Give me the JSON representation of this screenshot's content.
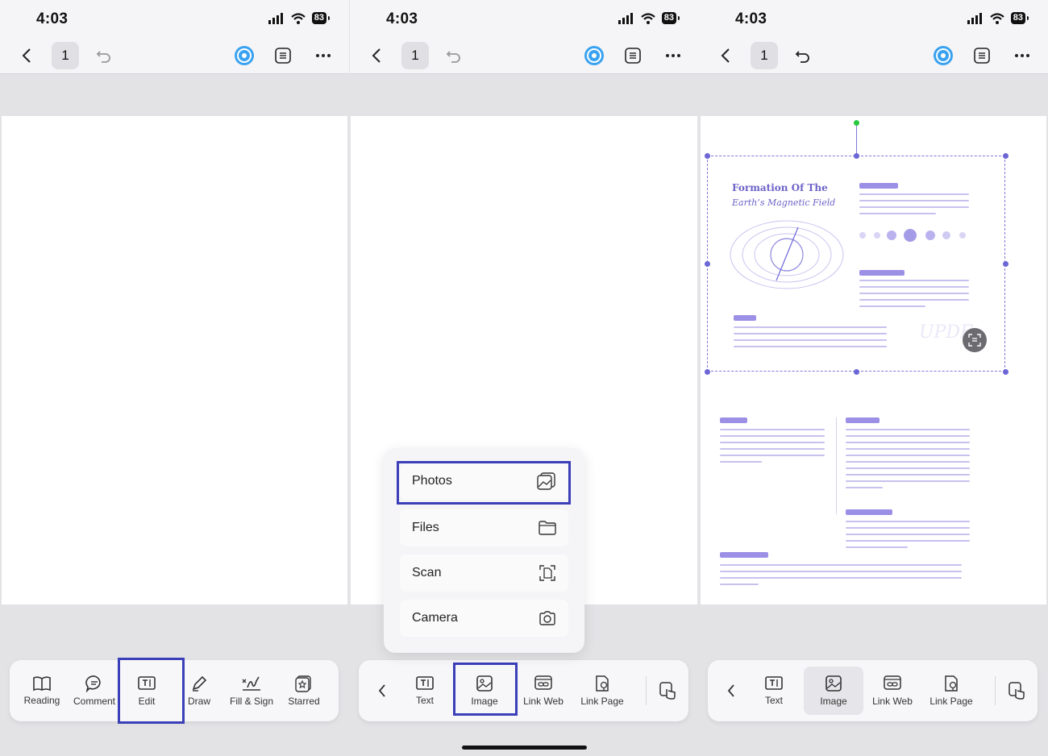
{
  "status": {
    "time": "4:03",
    "battery": "83"
  },
  "nav": {
    "page_number": "1"
  },
  "panel1": {
    "toolbar": [
      {
        "label": "Reading",
        "icon": "book-icon"
      },
      {
        "label": "Comment",
        "icon": "comment-icon"
      },
      {
        "label": "Edit",
        "icon": "edit-text-icon"
      },
      {
        "label": "Draw",
        "icon": "pen-icon"
      },
      {
        "label": "Fill & Sign",
        "icon": "signature-icon"
      },
      {
        "label": "Starred",
        "icon": "star-icon"
      }
    ]
  },
  "panel2": {
    "menu": [
      {
        "label": "Photos",
        "icon": "photos-icon"
      },
      {
        "label": "Files",
        "icon": "folder-icon"
      },
      {
        "label": "Scan",
        "icon": "scan-icon"
      },
      {
        "label": "Camera",
        "icon": "camera-icon"
      }
    ],
    "toolbar": [
      {
        "label": "Text",
        "icon": "text-box-icon"
      },
      {
        "label": "Image",
        "icon": "image-icon"
      },
      {
        "label": "Link Web",
        "icon": "link-web-icon"
      },
      {
        "label": "Link Page",
        "icon": "link-page-icon"
      }
    ]
  },
  "panel3": {
    "toolbar": [
      {
        "label": "Text",
        "icon": "text-box-icon"
      },
      {
        "label": "Image",
        "icon": "image-icon"
      },
      {
        "label": "Link Web",
        "icon": "link-web-icon"
      },
      {
        "label": "Link Page",
        "icon": "link-page-icon"
      }
    ],
    "document": {
      "title_line1": "Formation Of The",
      "title_line2": "Earth’s Magnetic Field",
      "watermark": "UPDF"
    }
  },
  "colors": {
    "highlight": "#3b3fb8",
    "accent": "#6c66d6",
    "page": "#ffffff",
    "background": "#e3e3e6"
  }
}
